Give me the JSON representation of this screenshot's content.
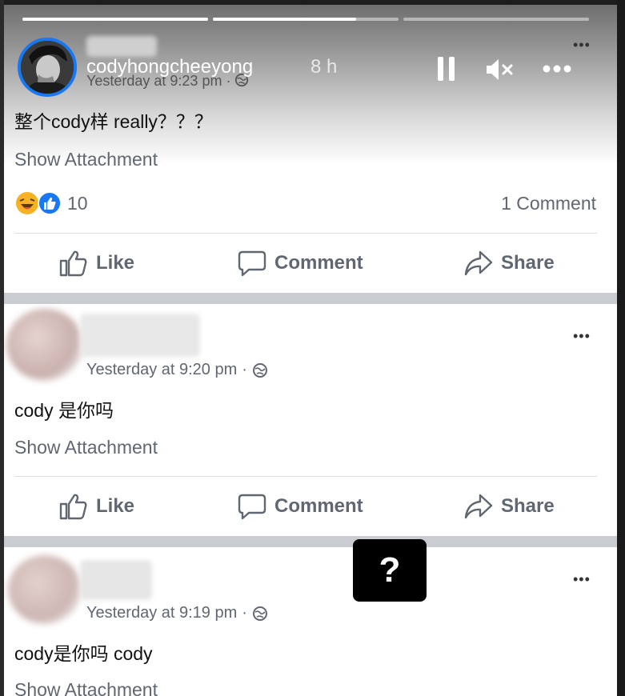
{
  "story": {
    "username": "codyhongcheeyong",
    "time_ago": "8 h",
    "controls": [
      "pause-icon",
      "mute-icon",
      "more-icon"
    ]
  },
  "posts": [
    {
      "timestamp": "Yesterday at 9:23 pm",
      "privacy_sep": "·",
      "text": "整个cody样 really？？？",
      "attachment_label": "Show Attachment",
      "reaction_count": "10",
      "comment_count": "1 Comment",
      "actions": {
        "like": "Like",
        "comment": "Comment",
        "share": "Share"
      }
    },
    {
      "timestamp": "Yesterday at 9:20 pm",
      "privacy_sep": "·",
      "text": "cody 是你吗",
      "attachment_label": "Show Attachment",
      "actions": {
        "like": "Like",
        "comment": "Comment",
        "share": "Share"
      }
    },
    {
      "timestamp": "Yesterday at 9:19 pm",
      "privacy_sep": "·",
      "text": "cody是你吗 cody",
      "attachment_label": "Show Attachment"
    }
  ],
  "overlay_badge": "?",
  "more_dots": "•••",
  "colors": {
    "accent": "#1877f2",
    "separator": "#c9ccd1",
    "muted_text": "#606770"
  }
}
